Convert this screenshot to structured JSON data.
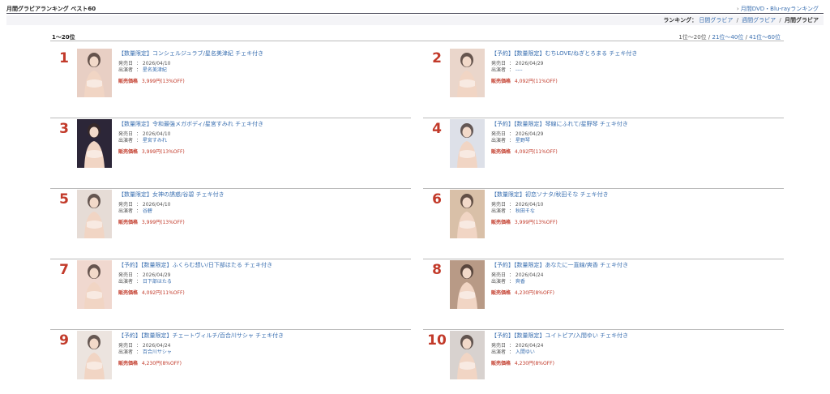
{
  "header": {
    "title": "月間グラビアランキング ベスト60",
    "dvd_link_prefix": "›",
    "dvd_link": "月間DVD・Blu-rayランキング"
  },
  "ranking_nav": {
    "label": "ランキング：",
    "daily": "日間グラビア",
    "weekly": "週間グラビア",
    "monthly": "月間グラビア",
    "sep": "/"
  },
  "range": {
    "current": "1〜20位",
    "pages_current": "1位〜20位",
    "page2": "21位〜40位",
    "page3": "41位〜60位",
    "sep": "/"
  },
  "labels": {
    "release": "発売日",
    "performer": "出演者",
    "price": "販売価格"
  },
  "items": [
    {
      "rank": "1",
      "title": "【数量限定】コンシェルジュラブ/星名美津紀 チェキ付き",
      "release": "2026/04/10",
      "performer": "星名美津紀",
      "price": "3,999円(13%OFF)",
      "tone": "#e8cfc4"
    },
    {
      "rank": "2",
      "title": "【予約】【数量限定】むちLOVE/ねぎとろまる チェキ付き",
      "release": "2026/04/29",
      "performer": "----",
      "price": "4,092円(11%OFF)",
      "tone": "#ead6cb"
    },
    {
      "rank": "3",
      "title": "【数量限定】令和最強メガボディ/星宮すみれ チェキ付き",
      "release": "2026/04/10",
      "performer": "星宮すみれ",
      "price": "3,999円(13%OFF)",
      "tone": "#2c2638"
    },
    {
      "rank": "4",
      "title": "【予約】【数量限定】琴線にふれて/星野琴 チェキ付き",
      "release": "2026/04/29",
      "performer": "星野琴",
      "price": "4,092円(11%OFF)",
      "tone": "#dde0e8"
    },
    {
      "rank": "5",
      "title": "【数量限定】女神の誘惑/谷碧 チェキ付き",
      "release": "2026/04/10",
      "performer": "谷碧",
      "price": "3,999円(13%OFF)",
      "tone": "#e6dcd6"
    },
    {
      "rank": "6",
      "title": "【数量限定】初恋ソナタ/秋田そな チェキ付き",
      "release": "2026/04/10",
      "performer": "秋田そな",
      "price": "3,999円(13%OFF)",
      "tone": "#d9c0a8"
    },
    {
      "rank": "7",
      "title": "【予約】【数量限定】ふくらむ想い/日下部ほたる チェキ付き",
      "release": "2026/04/29",
      "performer": "日下部ほたる",
      "price": "4,092円(11%OFF)",
      "tone": "#f0d8cf"
    },
    {
      "rank": "8",
      "title": "【予約】【数量限定】あなたに一直線/爽香 チェキ付き",
      "release": "2026/04/24",
      "performer": "爽香",
      "price": "4,230円(8%OFF)",
      "tone": "#b89a86"
    },
    {
      "rank": "9",
      "title": "【予約】【数量限定】チェートヴィルチ/百合川サシャ チェキ付き",
      "release": "2026/04/24",
      "performer": "百合川サシャ",
      "price": "4,230円(8%OFF)",
      "tone": "#ece4df"
    },
    {
      "rank": "10",
      "title": "【予約】【数量限定】ユイトピア/入間ゆい チェキ付き",
      "release": "2026/04/24",
      "performer": "入間ゆい",
      "price": "4,230円(8%OFF)",
      "tone": "#d8d2cf"
    }
  ]
}
